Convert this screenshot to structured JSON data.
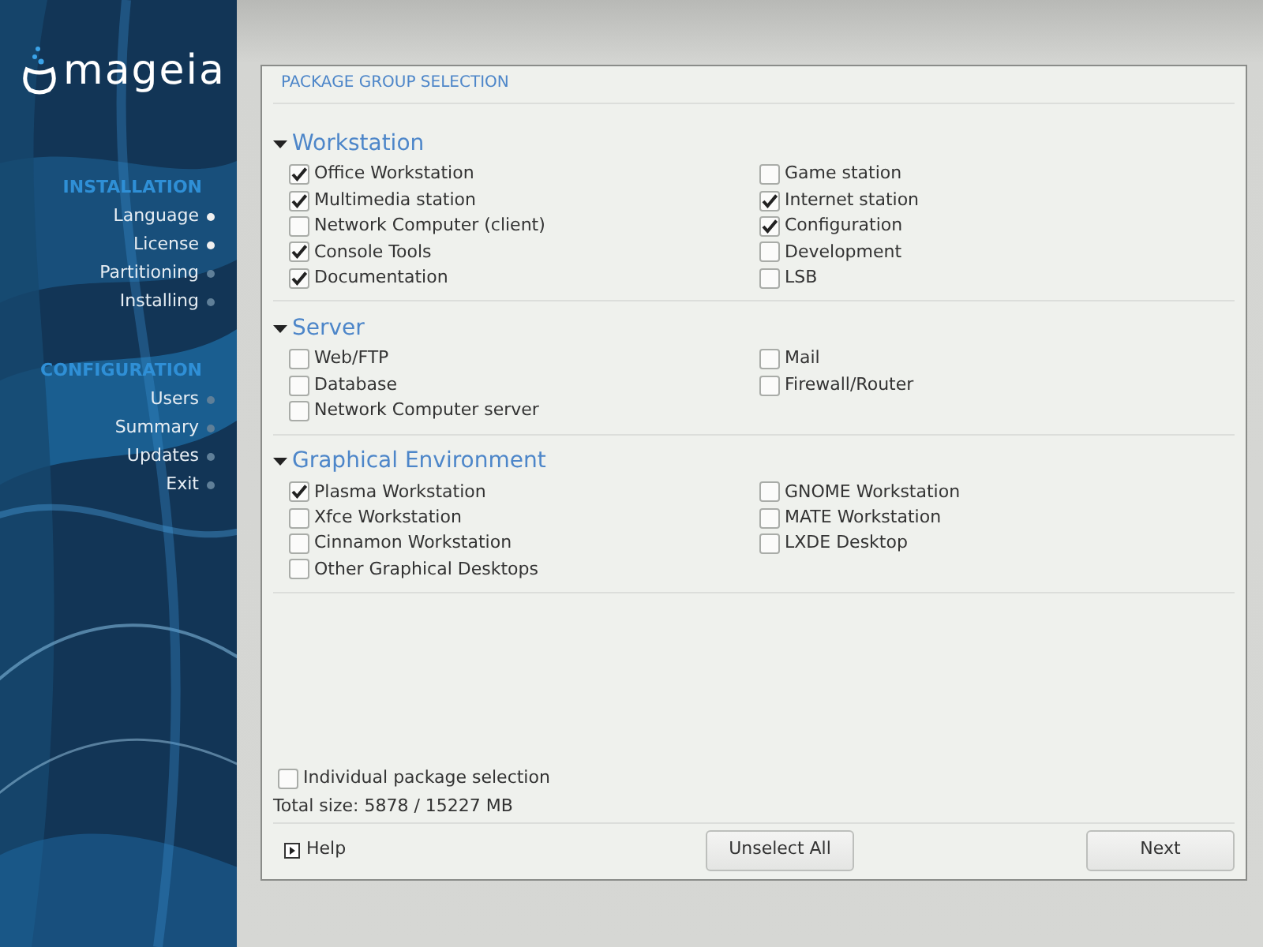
{
  "logo": {
    "text": "mageia"
  },
  "sidebar": {
    "sections": [
      {
        "title": "INSTALLATION",
        "steps": [
          {
            "label": "Language",
            "done": true
          },
          {
            "label": "License",
            "done": true
          },
          {
            "label": "Partitioning",
            "done": false
          },
          {
            "label": "Installing",
            "done": false
          }
        ]
      },
      {
        "title": "CONFIGURATION",
        "steps": [
          {
            "label": "Users",
            "done": false
          },
          {
            "label": "Summary",
            "done": false
          },
          {
            "label": "Updates",
            "done": false
          },
          {
            "label": "Exit",
            "done": false
          }
        ]
      }
    ]
  },
  "page_title": "PACKAGE GROUP SELECTION",
  "groups": [
    {
      "title": "Workstation",
      "expanded": true,
      "items": [
        {
          "label": "Office Workstation",
          "checked": true
        },
        {
          "label": "Game station",
          "checked": false
        },
        {
          "label": "Multimedia station",
          "checked": true
        },
        {
          "label": "Internet station",
          "checked": true
        },
        {
          "label": "Network Computer (client)",
          "checked": false
        },
        {
          "label": "Configuration",
          "checked": true
        },
        {
          "label": "Console Tools",
          "checked": true
        },
        {
          "label": "Development",
          "checked": false
        },
        {
          "label": "Documentation",
          "checked": true
        },
        {
          "label": "LSB",
          "checked": false
        }
      ]
    },
    {
      "title": "Server",
      "expanded": true,
      "items": [
        {
          "label": "Web/FTP",
          "checked": false
        },
        {
          "label": "Mail",
          "checked": false
        },
        {
          "label": "Database",
          "checked": false
        },
        {
          "label": "Firewall/Router",
          "checked": false
        },
        {
          "label": "Network Computer server",
          "checked": false
        }
      ]
    },
    {
      "title": "Graphical Environment",
      "expanded": true,
      "items": [
        {
          "label": "Plasma Workstation",
          "checked": true
        },
        {
          "label": "GNOME Workstation",
          "checked": false
        },
        {
          "label": "Xfce Workstation",
          "checked": false
        },
        {
          "label": "MATE Workstation",
          "checked": false
        },
        {
          "label": "Cinnamon Workstation",
          "checked": false
        },
        {
          "label": "LXDE Desktop",
          "checked": false
        },
        {
          "label": "Other Graphical Desktops",
          "checked": false
        }
      ]
    }
  ],
  "individual_selection": {
    "label": "Individual package selection",
    "checked": false
  },
  "total_size": "Total size: 5878 / 15227 MB",
  "buttons": {
    "help": "Help",
    "unselect_all": "Unselect All",
    "next": "Next"
  }
}
